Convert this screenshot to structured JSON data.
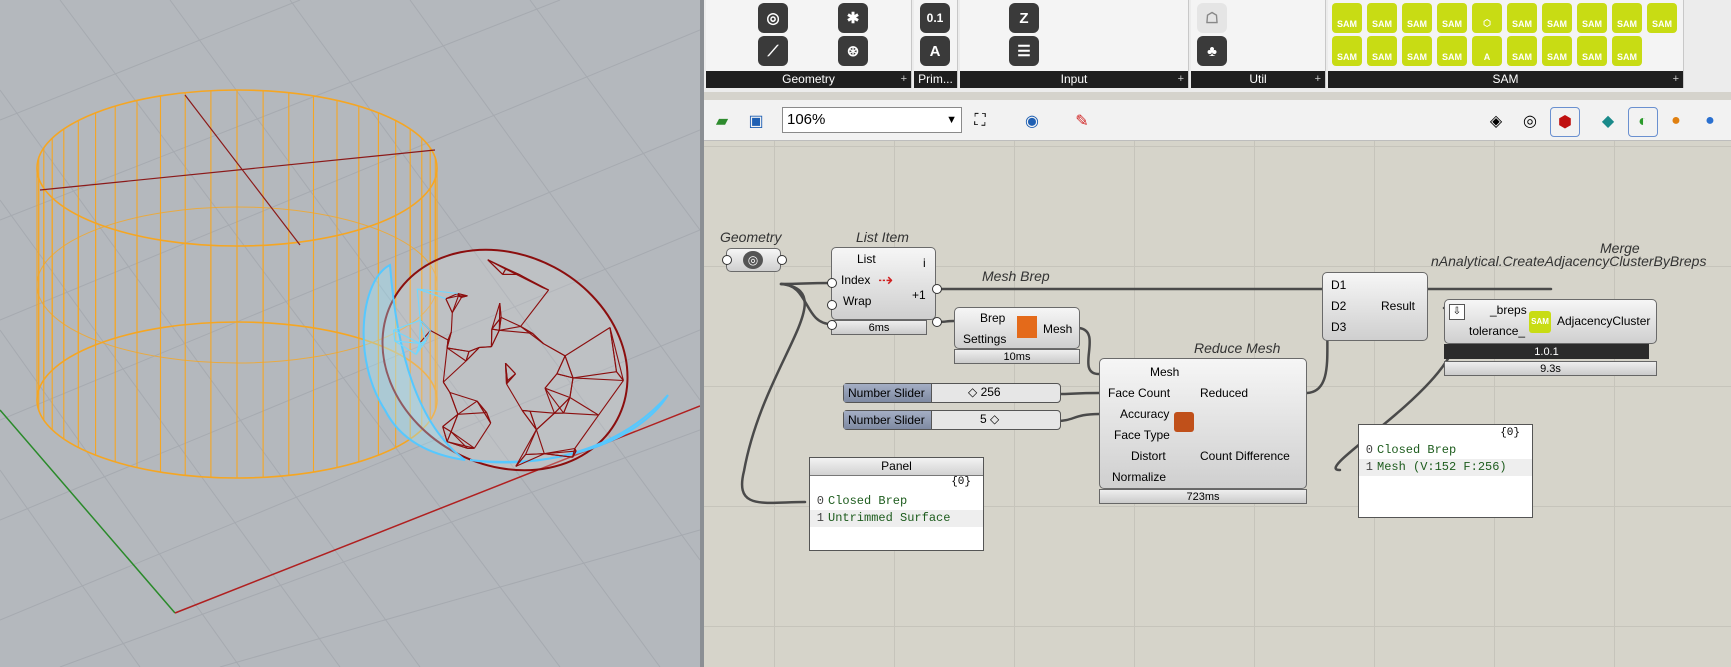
{
  "ribbon": {
    "groups": [
      {
        "label": "Geometry"
      },
      {
        "label": "Prim..."
      },
      {
        "label": "Input"
      },
      {
        "label": "Util"
      },
      {
        "label": "SAM"
      }
    ],
    "prim_icons": [
      "0.1",
      "A"
    ],
    "sam_badge": "SAM",
    "sam_a": "A"
  },
  "toolbar": {
    "zoom": "106%"
  },
  "components": {
    "geometry": {
      "title": "Geometry"
    },
    "list_item": {
      "title": "List Item",
      "inputs": [
        "List",
        "Index",
        "Wrap"
      ],
      "outputs": [
        "i",
        "+1"
      ],
      "time": "6ms"
    },
    "mesh_brep": {
      "title": "Mesh Brep",
      "inputs": [
        "Brep",
        "Settings"
      ],
      "output": "Mesh",
      "time": "10ms"
    },
    "reduce_mesh": {
      "title": "Reduce Mesh",
      "inputs": [
        "Mesh",
        "Face Count",
        "Accuracy",
        "Face Type",
        "Distort",
        "Normalize"
      ],
      "outputs": [
        "Reduced",
        "Count Difference"
      ],
      "time": "723ms"
    },
    "merge": {
      "title": "Merge",
      "inputs": [
        "D1",
        "D2",
        "D3"
      ],
      "output": "Result"
    },
    "adjacency": {
      "title": "nAnalytical.CreateAdjacencyClusterByBreps",
      "inputs": [
        "_breps",
        "tolerance_"
      ],
      "output": "AdjacencyCluster",
      "version": "1.0.1",
      "time": "9.3s"
    }
  },
  "sliders": [
    {
      "label": "Number Slider",
      "value": "256",
      "marker": "◇"
    },
    {
      "label": "Number Slider",
      "value": "5",
      "marker": "◇"
    }
  ],
  "panel1": {
    "header": "Panel",
    "path": "{0}",
    "rows": [
      {
        "index": "0",
        "text": "Closed Brep"
      },
      {
        "index": "1",
        "text": "Untrimmed Surface"
      }
    ]
  },
  "panel2": {
    "path": "{0}",
    "rows": [
      {
        "index": "0",
        "text": "Closed Brep"
      },
      {
        "index": "1",
        "text": "Mesh (V:152  F:256)"
      }
    ]
  },
  "colors": {
    "cylinder": "#f5a623",
    "mesh_red": "#8b0e0e",
    "mesh_cyan": "#56c8ff",
    "sam_green": "#c8dc14"
  }
}
